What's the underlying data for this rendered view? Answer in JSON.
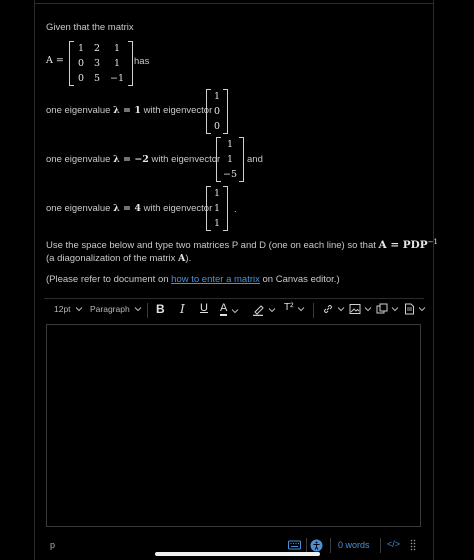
{
  "question": {
    "intro": "Given that the matrix",
    "matrix_label": "A =",
    "matrix_A": [
      [
        "1",
        "2",
        "1"
      ],
      [
        "0",
        "3",
        "1"
      ],
      [
        "0",
        "5",
        "−1"
      ]
    ],
    "has": "has",
    "eig1_prefix": "one eigenvalue",
    "eig1_lambda": "λ = 1",
    "eig1_suffix": "with eigenvector",
    "vec1": [
      "1",
      "0",
      "0"
    ],
    "eig2_prefix": "one eigenvalue",
    "eig2_lambda": "λ = −2",
    "eig2_suffix": "with eigenvector",
    "vec2": [
      "1",
      "1",
      "−5"
    ],
    "eig2_and": "and",
    "eig3_prefix": "one eigenvalue",
    "eig3_lambda": "λ = 4",
    "eig3_suffix": "with eigenvector",
    "vec3": [
      "1",
      "1",
      "1"
    ],
    "eig3_period": ".",
    "instruction_1": "Use the space below and type two matrices P and D (one on each line) so that",
    "instruction_eq": "A = PDP",
    "instruction_sup": "−1",
    "instruction_2a": "(a diagonalization of the matrix",
    "instruction_2b": "A",
    "instruction_2c": ").",
    "refer_a": "(Please refer to document on",
    "refer_link": "how to enter a matrix",
    "refer_b": "on Canvas editor.)"
  },
  "toolbar": {
    "font_size": "12pt",
    "paragraph": "Paragraph",
    "bold": "B",
    "italic": "I",
    "underline": "U",
    "text_color": "A",
    "superscript": "T²"
  },
  "status": {
    "path": "p",
    "word_count": "0 words",
    "html_toggle": "</>"
  },
  "colors": {
    "background": "#000000",
    "text": "#c9c9c9",
    "link": "#4a90d9",
    "accent": "#4a90d9"
  }
}
